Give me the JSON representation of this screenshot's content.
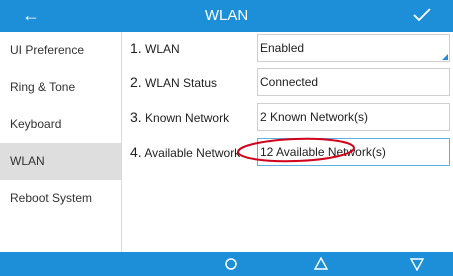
{
  "header": {
    "title": "WLAN",
    "back_icon": "back-arrow-icon",
    "confirm_icon": "check-icon",
    "color": "#1d8fd8"
  },
  "sidebar": {
    "items": [
      {
        "label": "UI Preference"
      },
      {
        "label": "Ring & Tone"
      },
      {
        "label": "Keyboard"
      },
      {
        "label": "WLAN"
      },
      {
        "label": "Reboot System"
      }
    ],
    "active": "WLAN"
  },
  "settings": {
    "rows": [
      {
        "num": "1.",
        "label": "WLAN",
        "value": "Enabled"
      },
      {
        "num": "2.",
        "label": "WLAN Status",
        "value": "Connected"
      },
      {
        "num": "3.",
        "label": "Known Network",
        "value": "2 Known Network(s)"
      },
      {
        "num": "4.",
        "label": "Available Network",
        "value": "12 Available Network(s)"
      }
    ],
    "highlight_color": "#d0021b"
  },
  "softkeys": {
    "icons": [
      "home-circle-icon",
      "up-triangle-icon",
      "down-triangle-icon"
    ]
  }
}
